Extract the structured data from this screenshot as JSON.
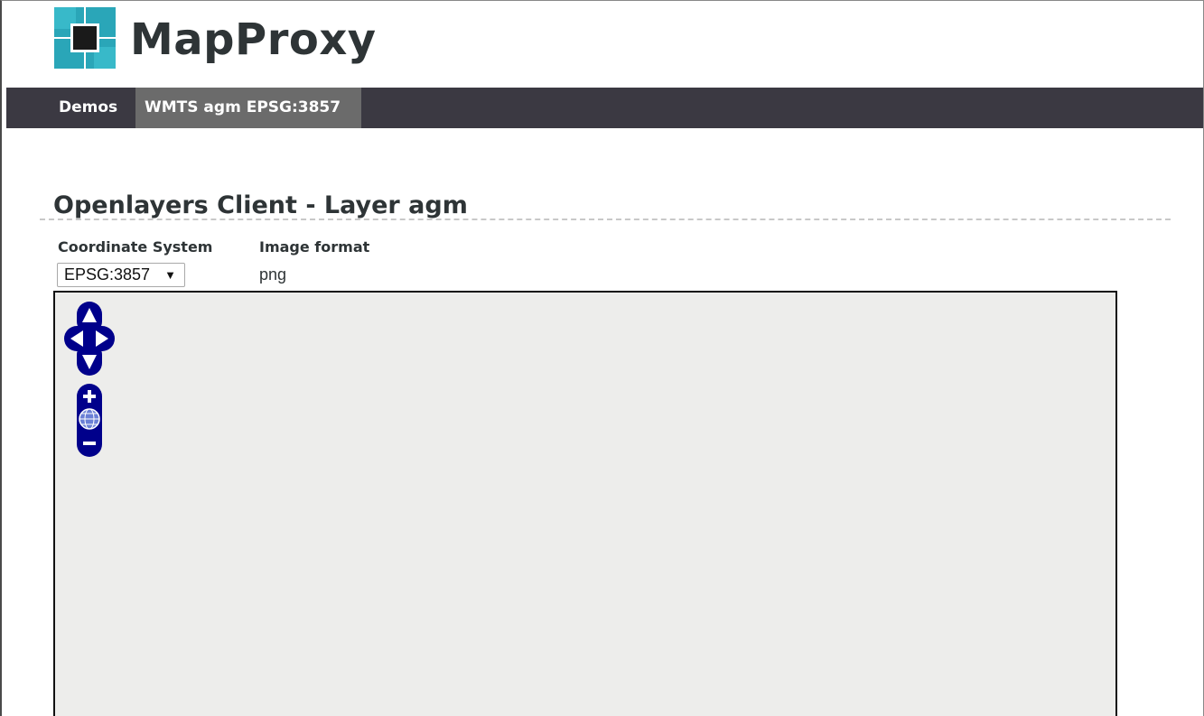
{
  "header": {
    "logo_text": "MapProxy",
    "logo_colors": {
      "teal": "#2aa6b8",
      "dark": "#1a1a1a"
    }
  },
  "nav": {
    "items": [
      {
        "label": "Demos",
        "active": false
      },
      {
        "label": "WMTS agm EPSG:3857",
        "active": true
      }
    ]
  },
  "page": {
    "title": "Openlayers Client - Layer agm"
  },
  "controls": {
    "crs_label": "Coordinate System",
    "crs_selected": "EPSG:3857",
    "format_label": "Image format",
    "format_value": "png"
  },
  "map": {
    "background": "#ededeb",
    "pan_icons": [
      "pan-up-icon",
      "pan-left-icon",
      "pan-right-icon",
      "pan-down-icon"
    ],
    "zoom_icons": [
      "zoom-in-icon",
      "zoom-world-icon",
      "zoom-out-icon"
    ],
    "control_color": "#00008b"
  }
}
